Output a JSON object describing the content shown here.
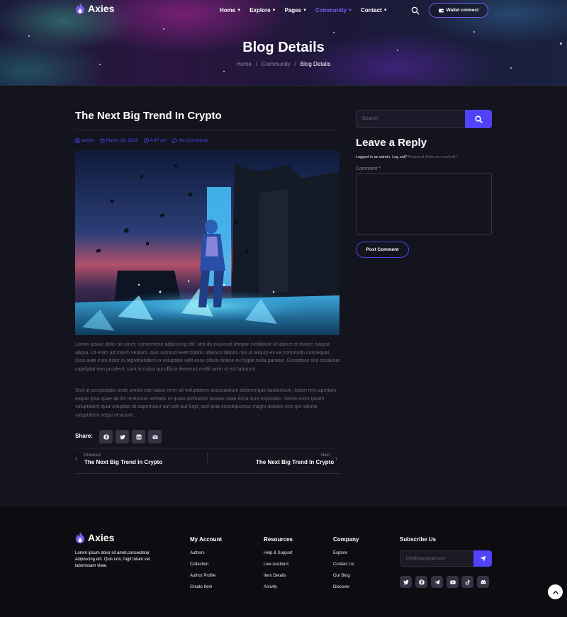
{
  "header": {
    "logo_text": "Axies",
    "nav": [
      {
        "label": "Home"
      },
      {
        "label": "Explore"
      },
      {
        "label": "Pages"
      },
      {
        "label": "Community"
      },
      {
        "label": "Contact"
      }
    ],
    "active_nav": "Community",
    "wallet_label": "Wallet connect"
  },
  "hero": {
    "title": "Blog Details",
    "breadcrumb": [
      "Home",
      "Community",
      "Blog Details"
    ],
    "separator": "/"
  },
  "post": {
    "title": "The Next Big Trend In Crypto",
    "author": "admin",
    "date": "March 18, 2022",
    "time": "4:47 pm",
    "comments": "No Comments",
    "paragraph1": "Lorem ipsum dolor sit amet, consectetur adipiscing elit, sed do eiusmod tempor incididunt ut labore et dolore magna aliqua. Ut enim ad minim veniam, quis nostrud exercitation ullamco laboris nisi ut aliquip ex ea commodo consequat. Duis aute irure dolor in reprehenderit in voluptate velit esse cillum dolore eu fugiat nulla pariatur. Excepteur sint occaecat cupidatat non proident, sunt in culpa qui officia deserunt mollit anim id est laborum.",
    "paragraph2": "Sed ut perspiciatis unde omnis iste natus error sit voluptatem accusantium doloremque laudantium, totam rem aperiam, eaque ipsa quae ab illo inventore veritatis et quasi architecto beatae vitae dicta sunt explicabo. Nemo enim ipsam voluptatem quia voluptas sit aspernatur aut odit aut fugit, sed quia consequuntur magni dolores eos qui ratione voluptatem sequi nesciunt.",
    "share_label": "Share:"
  },
  "post_nav": {
    "prev_label": "Previous",
    "prev_title": "The Next Big Trend In Crypto",
    "next_label": "Next",
    "next_title": "The Next Big Trend In Crypto"
  },
  "sidebar": {
    "search_placeholder": "Search",
    "reply_title": "Leave a Reply",
    "logged_in": "Logged in as admin",
    "log_out": "Log out?",
    "required_note": "Required fields are marked *",
    "comment_label": "Comment *",
    "post_button": "Post Comment"
  },
  "footer": {
    "logo_text": "Axies",
    "description": "Lorem ipsum dolor sit amet,consectetur adipisicing elit. Quis non, fugit totam vel laboriosam vitae.",
    "my_account": {
      "title": "My Account",
      "links": [
        "Authors",
        "Collection",
        "Author Profile",
        "Create Item"
      ]
    },
    "resources": {
      "title": "Resources",
      "links": [
        "Help & Support",
        "Live Auctions",
        "Item Details",
        "Activity"
      ]
    },
    "company": {
      "title": "Company",
      "links": [
        "Explore",
        "Contact Us",
        "Our Blog",
        "Discover"
      ]
    },
    "subscribe": {
      "title": "Subscribe Us",
      "placeholder": "info@yourgmail.com"
    },
    "social_icons": [
      "twitter-icon",
      "facebook-icon",
      "telegram-icon",
      "youtube-icon",
      "tiktok-icon",
      "discord-icon"
    ]
  },
  "colors": {
    "accent": "#5142fc",
    "background": "#14141f",
    "footer_bg": "#0d0d11"
  }
}
